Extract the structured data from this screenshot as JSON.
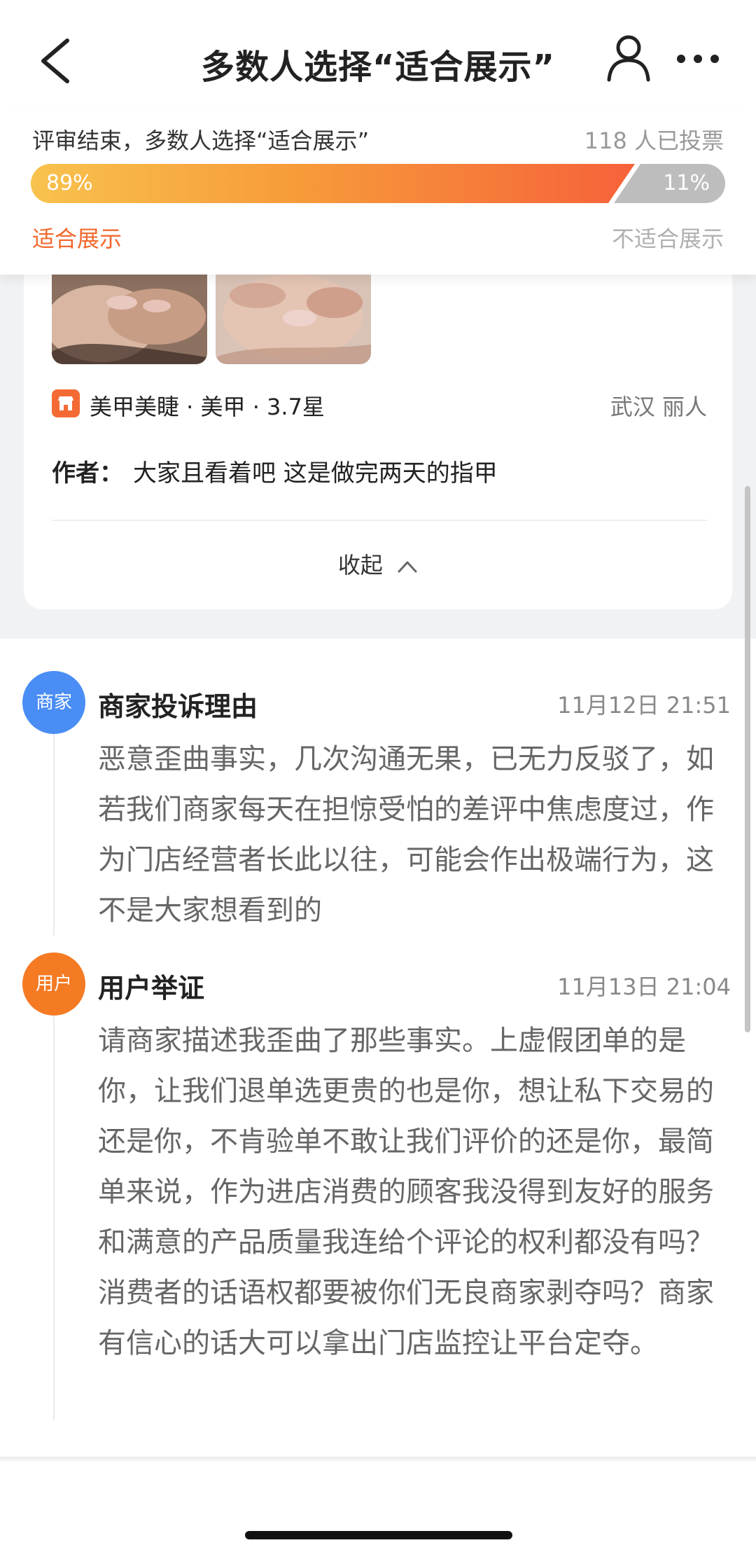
{
  "header": {
    "title": "多数人选择“适合展示”",
    "back_icon": "chevron-left-icon",
    "user_icon": "user-icon",
    "more_icon": "more-dots-icon"
  },
  "vote": {
    "status": "评审结束，多数人选择“适合展示”",
    "count": "118 人已投票",
    "suitable_percent_label": "89%",
    "unsuitable_percent_label": "11%",
    "suitable_fraction": 0.87,
    "suitable_label": "适合展示",
    "unsuitable_label": "不适合展示",
    "colors": {
      "accent": "#f2682d",
      "bar_start": "#f8c24e",
      "bar_end": "#f6623a",
      "bar_rest": "#bdbdbd"
    }
  },
  "review": {
    "shop": "美甲美睫 · 美甲 · 3.7星",
    "location": "武汉  丽人",
    "author_label": "作者：",
    "author_text": "大家且看着吧 这是做完两天的指甲",
    "collapse_label": "收起"
  },
  "timeline": {
    "merchant": {
      "avatar": "商家",
      "title": "商家投诉理由",
      "time": "11月12日   21:51",
      "text": "恶意歪曲事实，几次沟通无果，已无力反驳了，如若我们商家每天在担惊受怕的差评中焦虑度过，作为门店经营者长此以往，可能会作出极端行为，这不是大家想看到的"
    },
    "user": {
      "avatar": "用户",
      "title": "用户举证",
      "time": "11月13日   21:04",
      "text": "请商家描述我歪曲了那些事实。上虚假团单的是你，让我们退单选更贵的也是你，想让私下交易的还是你，不肯验单不敢让我们评价的还是你，最简单来说，作为进店消费的顾客我没得到友好的服务和满意的产品质量我连给个评论的权利都没有吗？消费者的话语权都要被你们无良商家剥夺吗？商家有信心的话大可以拿出门店监控让平台定夺。"
    }
  }
}
